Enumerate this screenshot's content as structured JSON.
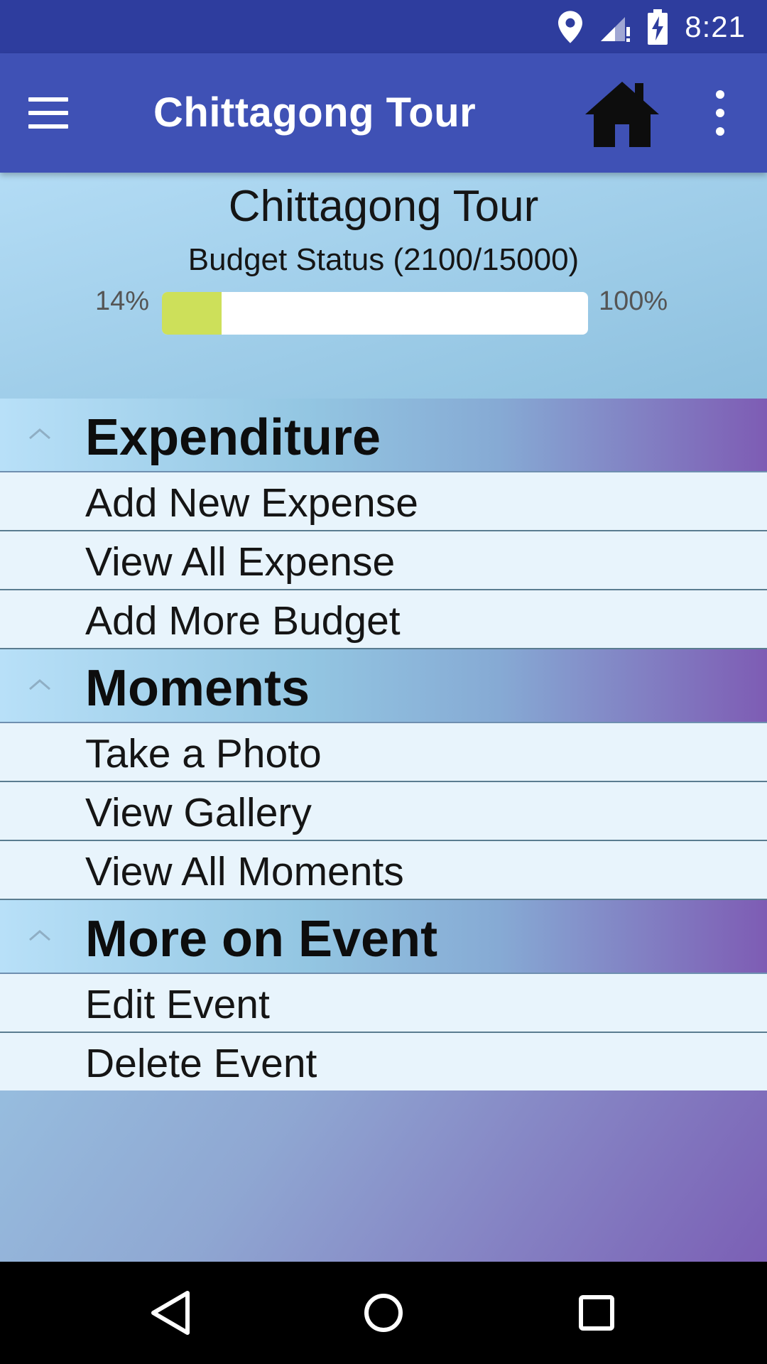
{
  "status_bar": {
    "time": "8:21",
    "icons": [
      "location-icon",
      "signal-icon",
      "battery-charging-icon"
    ]
  },
  "app_bar": {
    "title": "Chittagong Tour",
    "icons": [
      "menu-icon",
      "home-icon",
      "more-vert-icon"
    ]
  },
  "event": {
    "title": "Chittagong Tour",
    "budget_status": "Budget Status (2100/15000)",
    "progress_min_label": "14%",
    "progress_max_label": "100%",
    "progress_fraction": 0.14
  },
  "groups": [
    {
      "title": "Expenditure",
      "items": [
        "Add New Expense",
        "View All Expense",
        "Add More Budget"
      ]
    },
    {
      "title": "Moments",
      "items": [
        "Take a Photo",
        "View Gallery",
        "View All Moments"
      ]
    },
    {
      "title": "More on Event",
      "items": [
        "Edit Event",
        "Delete Event"
      ]
    }
  ],
  "nav_bar": {
    "icons": [
      "back-icon",
      "home-circle-icon",
      "recents-icon"
    ]
  },
  "colors": {
    "status_bar": "#2e3d9e",
    "app_bar": "#3f51b5",
    "progress_fill": "#cde05a",
    "list_item_bg": "#e8f4fc"
  }
}
